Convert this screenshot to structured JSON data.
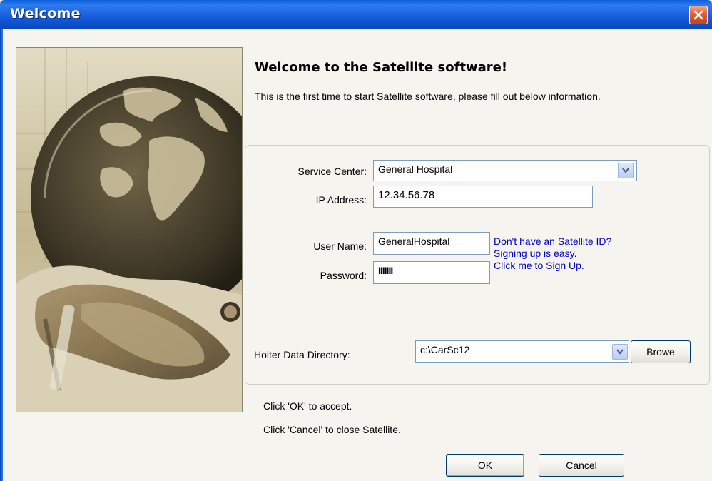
{
  "window": {
    "title": "Welcome",
    "close_icon": "close-icon"
  },
  "welcome": {
    "heading": "Welcome to the Satellite software!",
    "intro": "This is the first time to start Satellite software, please fill out below information."
  },
  "form": {
    "service_center": {
      "label": "Service Center:",
      "value": "General Hospital"
    },
    "ip_address": {
      "label": "IP Address:",
      "value": "12.34.56.78"
    },
    "user_name": {
      "label": "User Name:",
      "value": "GeneralHospital"
    },
    "password": {
      "label": "Password:",
      "value": "IIIIIII"
    },
    "signup": {
      "line1": "Don't have an Satellite ID?",
      "line2": "Signing up is easy.",
      "line3": "Click me to Sign Up."
    },
    "holter_directory": {
      "label": "Holter Data Directory:",
      "value": "c:\\CarSc12",
      "browse_label": "Browe"
    }
  },
  "hints": {
    "ok_hint": "Click 'OK' to accept.",
    "cancel_hint": "Click 'Cancel' to close Satellite."
  },
  "buttons": {
    "ok": "OK",
    "cancel": "Cancel"
  },
  "colors": {
    "titlebar": "#0c52d0",
    "link": "#0000cc",
    "window_bg": "#f5f4ef"
  }
}
